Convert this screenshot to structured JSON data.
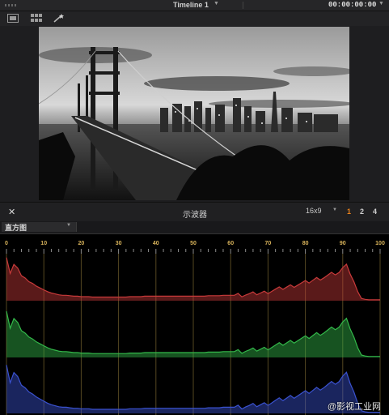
{
  "title_bar": {
    "timeline_name": "Timeline 1",
    "timecode": "00:00:00:00"
  },
  "viewer_toolbar": {
    "icons": [
      "single-viewer-icon",
      "grid-view-icon",
      "magic-wand-icon"
    ]
  },
  "scopes": {
    "title": "示波器",
    "aspect_ratio": "16x9",
    "layout_options": [
      "1",
      "2",
      "4"
    ],
    "selected_layout": "1",
    "mode": "直方图"
  },
  "colors": {
    "accent": "#e8811c",
    "tick": "#d7b25a",
    "red": "#c83a3a",
    "green": "#33b84a",
    "blue": "#3a52d0"
  },
  "chart_data": {
    "type": "area",
    "x_ticks": [
      0,
      10,
      20,
      30,
      40,
      50,
      60,
      70,
      80,
      90,
      100
    ],
    "xlim": [
      0,
      100
    ],
    "grid": true,
    "series": [
      {
        "channel": "red",
        "values": [
          95,
          60,
          80,
          72,
          55,
          50,
          42,
          38,
          32,
          28,
          24,
          20,
          17,
          15,
          13,
          12,
          12,
          11,
          10,
          10,
          9,
          9,
          9,
          8,
          8,
          8,
          8,
          8,
          8,
          8,
          8,
          8,
          8,
          9,
          9,
          9,
          9,
          10,
          10,
          10,
          10,
          10,
          10,
          10,
          10,
          10,
          10,
          10,
          10,
          10,
          10,
          10,
          10,
          10,
          11,
          11,
          11,
          11,
          12,
          12,
          12,
          12,
          13,
          13,
          14,
          14,
          15,
          16,
          17,
          18,
          20,
          22,
          24,
          26,
          28,
          30,
          32,
          34,
          36,
          38,
          40,
          42,
          45,
          48,
          50,
          52,
          55,
          58,
          60,
          62,
          70,
          85,
          60,
          40,
          20,
          5,
          3,
          2,
          2,
          2,
          2
        ]
      },
      {
        "channel": "green",
        "values": [
          95,
          60,
          80,
          72,
          55,
          50,
          42,
          38,
          32,
          28,
          24,
          20,
          17,
          15,
          13,
          12,
          12,
          11,
          10,
          10,
          9,
          9,
          9,
          8,
          8,
          8,
          8,
          8,
          8,
          8,
          8,
          8,
          8,
          9,
          9,
          9,
          9,
          10,
          10,
          10,
          10,
          10,
          10,
          10,
          10,
          10,
          10,
          10,
          10,
          10,
          10,
          10,
          10,
          10,
          11,
          11,
          11,
          11,
          12,
          12,
          12,
          12,
          13,
          13,
          14,
          14,
          15,
          16,
          17,
          18,
          20,
          22,
          24,
          26,
          28,
          30,
          32,
          34,
          36,
          38,
          40,
          42,
          45,
          48,
          50,
          52,
          55,
          58,
          60,
          62,
          70,
          85,
          60,
          40,
          20,
          5,
          3,
          2,
          2,
          2,
          2
        ]
      },
      {
        "channel": "blue",
        "values": [
          95,
          60,
          80,
          72,
          55,
          50,
          42,
          38,
          32,
          28,
          24,
          20,
          17,
          15,
          13,
          12,
          12,
          11,
          10,
          10,
          9,
          9,
          9,
          8,
          8,
          8,
          8,
          8,
          8,
          8,
          8,
          8,
          8,
          9,
          9,
          9,
          9,
          10,
          10,
          10,
          10,
          10,
          10,
          10,
          10,
          10,
          10,
          10,
          10,
          10,
          10,
          10,
          10,
          10,
          11,
          11,
          11,
          11,
          12,
          12,
          12,
          12,
          13,
          13,
          14,
          14,
          15,
          16,
          17,
          18,
          20,
          22,
          24,
          26,
          28,
          30,
          32,
          34,
          36,
          38,
          40,
          42,
          45,
          48,
          50,
          52,
          55,
          58,
          60,
          62,
          70,
          85,
          60,
          40,
          20,
          5,
          3,
          2,
          2,
          2,
          2
        ]
      }
    ]
  },
  "watermark": "@影视工业网"
}
